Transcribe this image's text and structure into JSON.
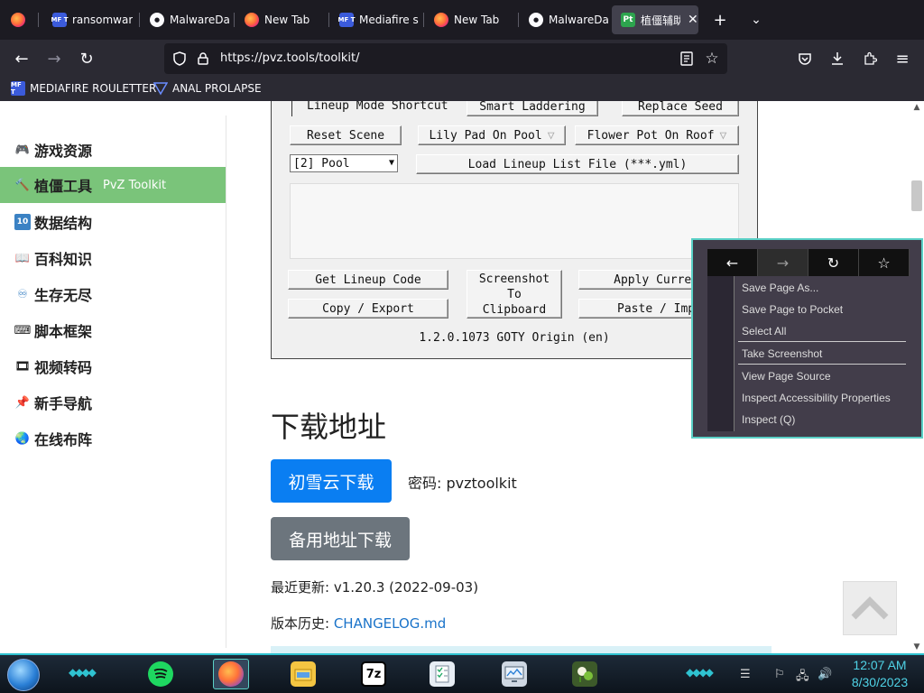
{
  "browser": {
    "tabs": [
      {
        "title": "ransomwar",
        "icon": "firefox-icon"
      },
      {
        "title": "MalwareDa",
        "icon": "github-icon"
      },
      {
        "title": "New Tab",
        "icon": "firefox-icon"
      },
      {
        "title": "Mediafire s",
        "icon": "mediafire-icon"
      },
      {
        "title": "New Tab",
        "icon": "firefox-icon"
      },
      {
        "title": "MalwareDa",
        "icon": "github-icon"
      },
      {
        "title": "植僵辅助",
        "icon": "pt-icon",
        "active": true
      }
    ],
    "favicon_labels": {
      "mediafire": "MF T",
      "pt": "Pt"
    },
    "url": "https://pvz.tools/toolkit/",
    "bookmarks": [
      {
        "label": "MEDIAFIRE ROULETTER",
        "icon": "mediafire-icon"
      },
      {
        "label": "ANAL PROLAPSE",
        "icon": "bookmark-icon"
      }
    ]
  },
  "sidebar": {
    "items": [
      {
        "label": "游戏资源",
        "icon": "gamepad-icon"
      },
      {
        "label": "植僵工具",
        "sub": "PvZ Toolkit",
        "icon": "hammer-icon",
        "active": true
      },
      {
        "label": "数据结构",
        "icon": "number-ten-icon"
      },
      {
        "label": "百科知识",
        "icon": "book-icon"
      },
      {
        "label": "生存无尽",
        "icon": "infinity-icon"
      },
      {
        "label": "脚本框架",
        "icon": "keyboard-icon"
      },
      {
        "label": "视频转码",
        "icon": "film-icon"
      },
      {
        "label": "新手导航",
        "icon": "pushpin-icon"
      },
      {
        "label": "在线布阵",
        "icon": "globe-icon"
      }
    ]
  },
  "toolkit": {
    "lineup_mode_shortcut": "Lineup Mode Shortcut",
    "smart_laddering": "Smart Laddering",
    "replace_seed": "Replace Seed",
    "reset_scene": "Reset Scene",
    "lily_pad_on_pool": "Lily Pad On Pool",
    "flower_pot_on_roof": "Flower Pot On Roof",
    "scene_select": "[2] Pool",
    "load_lineup": "Load Lineup List File (***.yml)",
    "get_lineup_code": "Get Lineup Code",
    "copy_export": "Copy / Export",
    "screenshot_clipboard": "Screenshot\nTo\nClipboard",
    "apply_current": "Apply Current",
    "paste_import": "Paste / Impo",
    "version": "1.2.0.1073 GOTY Origin (en)"
  },
  "main": {
    "download_heading": "下载地址",
    "primary_download": "初雪云下载",
    "password": "密码: pvztoolkit",
    "backup_download": "备用地址下载",
    "last_update": "最近更新: v1.20.3 (2022-09-03)",
    "history_label": "版本历史: ",
    "history_link": "CHANGELOG.md"
  },
  "context_menu": {
    "items": [
      "Save Page As...",
      "Save Page to Pocket",
      "Select All",
      "Take Screenshot",
      "View Page Source",
      "Inspect Accessibility Properties",
      "Inspect (Q)"
    ]
  },
  "taskbar": {
    "time": "12:07 AM",
    "date": "8/30/2023",
    "apps": [
      "spotify-icon",
      "firefox-icon",
      "file-explorer-icon",
      "7zip-icon",
      "tasks-icon",
      "monitor-icon",
      "plants-vs-zombies-icon"
    ],
    "app_labels": {
      "sevenzip": "7z"
    }
  }
}
